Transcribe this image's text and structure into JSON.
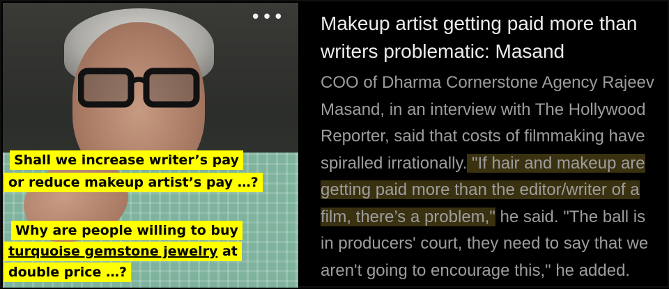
{
  "video": {
    "more_icon": "more-horizontal-icon",
    "more_glyph": "•••"
  },
  "captions": {
    "q1_line1": "Shall  we  increase  writer’s  pay",
    "q1_line2": "or  reduce  makeup  artist’s  pay  …?",
    "q2_line1": "Why  are  people  willing  to  buy",
    "q2_line2_a": "turquoise  gemstone  jewelry",
    "q2_line2_b": "  at",
    "q2_line3": "double  price  …?",
    "highlight_color": "#ffff00"
  },
  "article": {
    "headline": "Makeup artist getting paid more than writers problematic: Masand",
    "body_plain": "COO of Dharma Cornerstone Agency Rajeev Masand, in an interview with The Hollywood Reporter, said that costs of filmmaking have spiralled irrationally.",
    "body_quote": " \"If hair and makeup are getting paid more than the editor/writer of a film, there’s a problem,\"",
    "body_rest": " he said. \"The ball is in producers' court, they need to say that we aren't going to encourage this,\" he added.",
    "quote_highlight_color": "#3a3110"
  }
}
